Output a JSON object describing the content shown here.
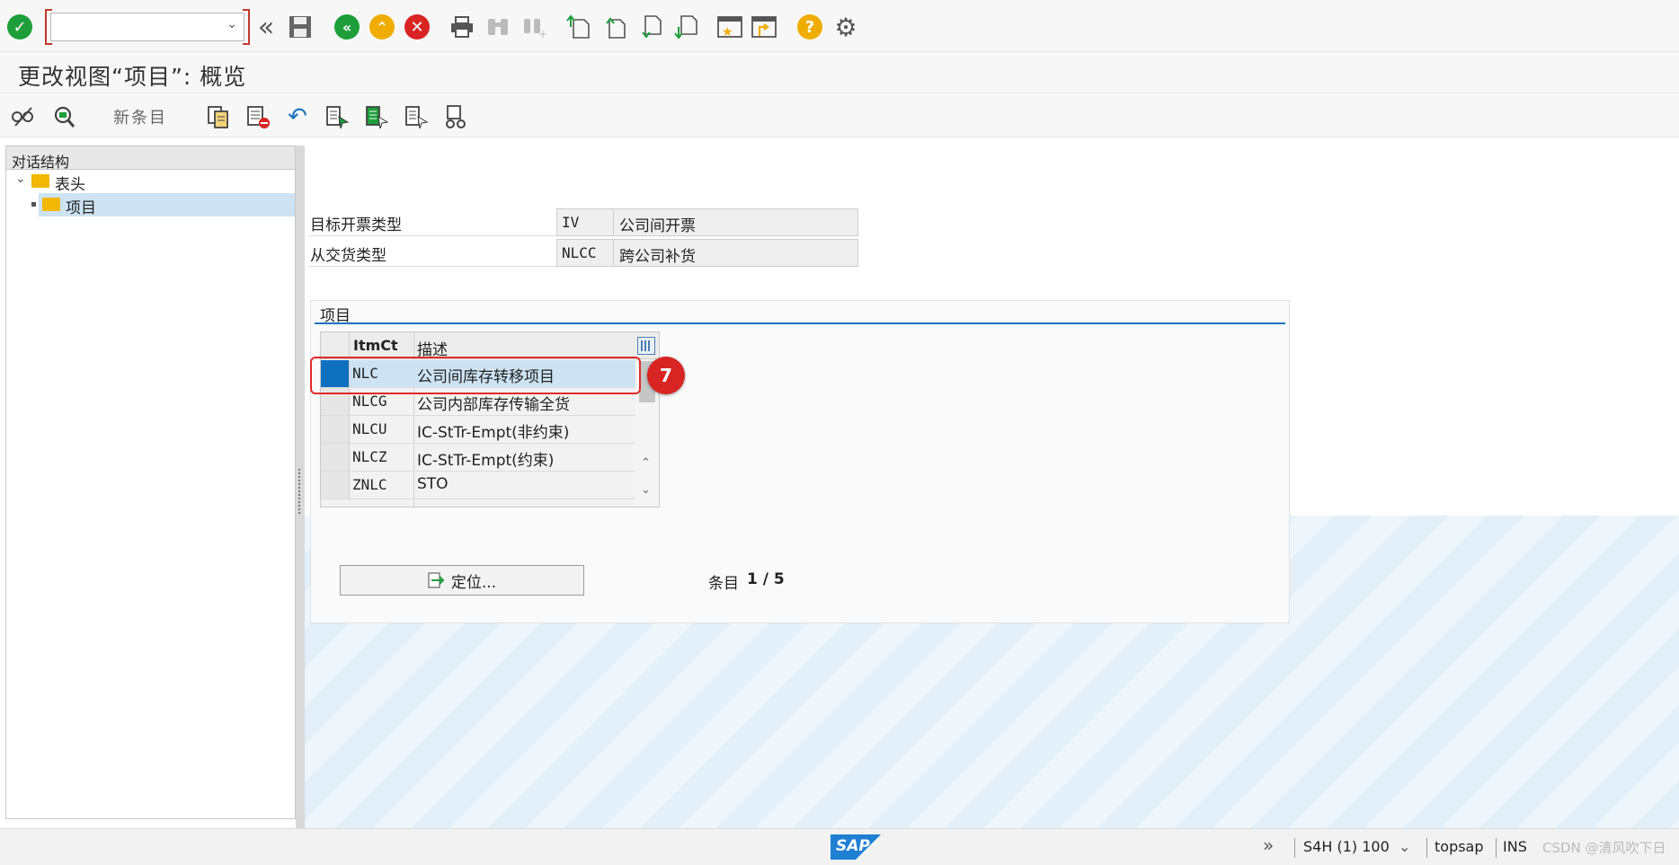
{
  "toolbar": {
    "command_field_value": "",
    "icons": [
      "check-icon",
      "command-field",
      "back-double-icon",
      "save-icon",
      "back-icon",
      "exit-icon",
      "cancel-icon",
      "print-icon",
      "find-icon",
      "find-next-icon",
      "first-page-icon",
      "previous-page-icon",
      "next-page-icon",
      "last-page-icon",
      "create-session-icon",
      "generate-shortcut-icon",
      "help-icon",
      "settings-icon"
    ]
  },
  "title": "更改视图“项目”: 概览",
  "app_toolbar": {
    "new_entries_label": "新条目"
  },
  "tree": {
    "header": "对话结构",
    "items": [
      {
        "label": "表头",
        "level": 0,
        "expanded": true
      },
      {
        "label": "项目",
        "level": 1,
        "selected": true
      }
    ]
  },
  "header_fields": [
    {
      "label": "目标开票类型",
      "code": "IV",
      "text": "公司间开票"
    },
    {
      "label": "从交货类型",
      "code": "NLCC",
      "text": "跨公司补货"
    }
  ],
  "items_group": {
    "title": "项目",
    "columns": [
      "ItmCt",
      "描述"
    ],
    "rows": [
      {
        "code": "NLC",
        "desc": "公司间库存转移项目",
        "selected": true
      },
      {
        "code": "NLCG",
        "desc": "公司内部库存传输全货"
      },
      {
        "code": "NLCU",
        "desc": "IC-StTr-Empt(非约束)"
      },
      {
        "code": "NLCZ",
        "desc": "IC-StTr-Empt(约束)"
      },
      {
        "code": "ZNLC",
        "desc": "STO"
      }
    ],
    "position_button": "定位...",
    "entry_label": "条目",
    "entry_value": "1 / 5"
  },
  "annotation_badge": "7",
  "status_bar": {
    "logo": "SAP",
    "system": "S4H (1) 100",
    "server": "topsap",
    "mode": "INS",
    "watermark": "CSDN @清风吹下日"
  },
  "colors": {
    "accent_blue": "#1b75bc",
    "selection_blue": "#1070c0",
    "highlight_red": "#e02b2b",
    "ok_green": "#1e9e3a",
    "warning_yellow": "#f0ad00"
  }
}
